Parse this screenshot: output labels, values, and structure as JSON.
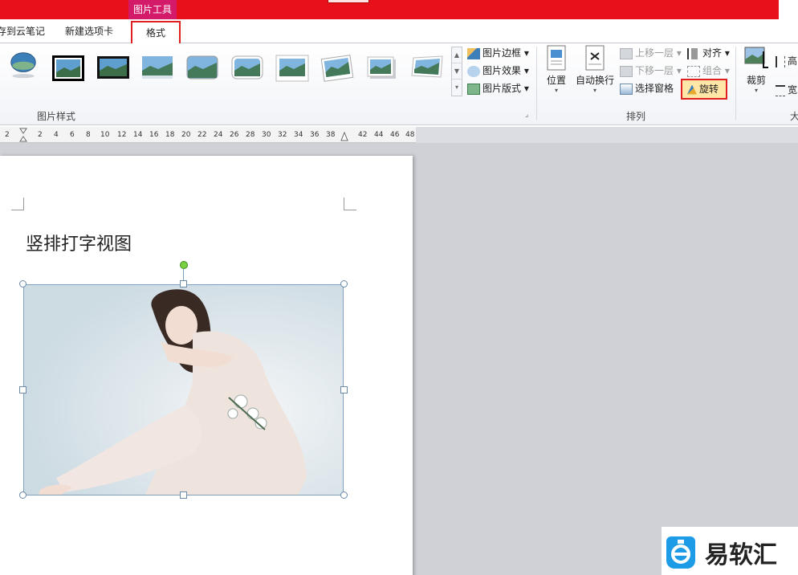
{
  "title_bar": {
    "context_tab": "图片工具"
  },
  "tabs": {
    "cloud": "存到云笔记",
    "new_tab": "新建选项卡",
    "format": "格式"
  },
  "ribbon": {
    "picture_styles": {
      "label": "图片样式",
      "border": "图片边框",
      "effects": "图片效果",
      "layout": "图片版式"
    },
    "arrange": {
      "label": "排列",
      "position": "位置",
      "wrap_text": "自动换行",
      "bring_forward": "上移一层",
      "send_backward": "下移一层",
      "selection_pane": "选择窗格",
      "align": "对齐",
      "group": "组合",
      "rotate": "旋转"
    },
    "size": {
      "crop": "裁剪",
      "height": "高",
      "width": "宽",
      "label": "大"
    }
  },
  "ruler": {
    "ticks": [
      "2",
      "2",
      "4",
      "6",
      "8",
      "10",
      "12",
      "14",
      "16",
      "18",
      "20",
      "22",
      "24",
      "26",
      "28",
      "30",
      "32",
      "34",
      "36",
      "38",
      "42",
      "44",
      "46",
      "48"
    ]
  },
  "document": {
    "heading": "竖排打字视图"
  },
  "watermark": {
    "text": "易软汇"
  },
  "colors": {
    "accent_red": "#e8101b",
    "context_tab": "#d41b6a",
    "highlight_box": "#e02020"
  }
}
